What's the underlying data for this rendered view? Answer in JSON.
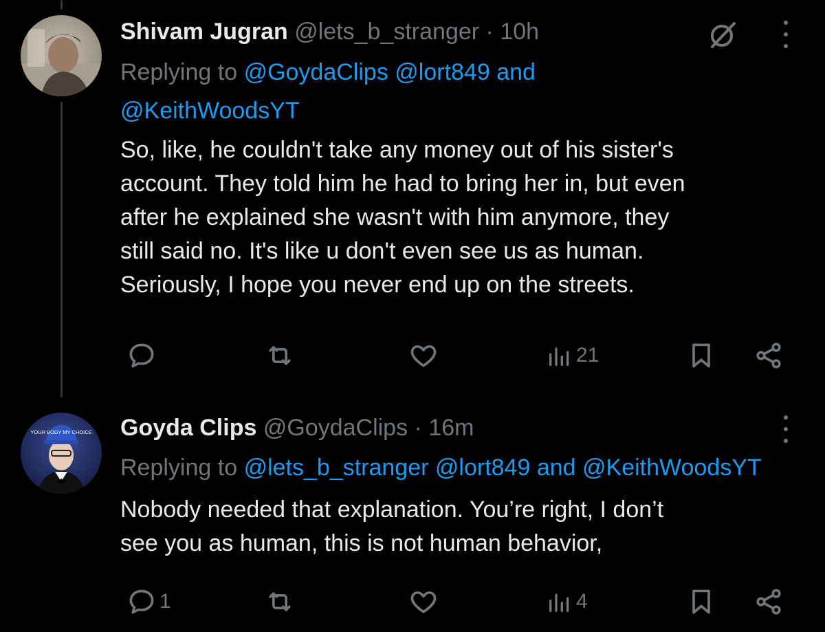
{
  "tweets": [
    {
      "name": "Shivam Jugran",
      "handle": "@lets_b_stranger",
      "time": "· 10h",
      "replying_prefix": "Replying to",
      "replying_line1_mentions": "@GoydaClips @lort849",
      "replying_and": "and",
      "replying_line2_mention": "@KeithWoodsYT",
      "body_lines": [
        "So, like, he couldn't take any money out of his sister's",
        "account. They told him he had to bring her in, but even",
        "after he explained she wasn't with him anymore, they",
        "still said no. It's like u don't even see us as human.",
        "Seriously, I hope you never end up on the streets."
      ],
      "actions": {
        "replies": "",
        "reposts": "",
        "likes": "",
        "views": "21"
      },
      "grok_icon": "grok-icon"
    },
    {
      "name": "Goyda Clips",
      "handle": "@GoydaClips",
      "time": "· 16m",
      "replying_prefix": "Replying to",
      "replying_mentions": "@lets_b_stranger @lort849",
      "replying_and": "and",
      "replying_last": "@KeithWoodsYT",
      "body_lines": [
        "Nobody needed that explanation. You’re right, I don’t",
        "see you as human, this is not human behavior,"
      ],
      "avatar_cap_text": "YOUR BODY MY CHOICE",
      "actions": {
        "replies": "1",
        "reposts": "",
        "likes": "",
        "views": "4"
      }
    }
  ],
  "colors": {
    "background": "#000000",
    "text": "#e7e9ea",
    "muted": "#71767b",
    "link": "#1d9bf0",
    "thread_line": "#333639"
  }
}
